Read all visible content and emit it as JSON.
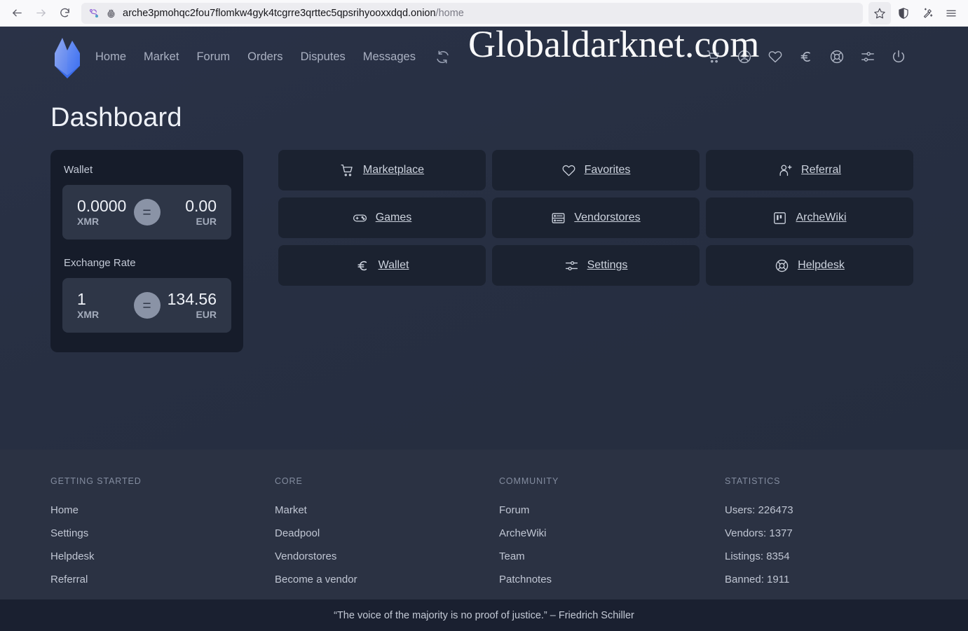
{
  "browser": {
    "back_icon": "back-arrow-icon",
    "forward_icon": "forward-arrow-icon",
    "reload_icon": "reload-icon",
    "tor_circuit_icon": "tor-circuit-icon",
    "onion_icon": "onion-site-icon",
    "url": "arche3pmohqc2fou7flomkw4gyk4tcgrre3qrttec5qpsrihyooxxdqd.onion",
    "url_path": "/home",
    "bookmark_icon": "star-bookmark-icon",
    "shield_icon": "shield-icon",
    "cleanup_icon": "sparkle-cleanup-icon",
    "menu_icon": "hamburger-menu-icon"
  },
  "watermark": "Globaldarknet.com",
  "header": {
    "logo_icon": "arche-crown-logo-icon",
    "nav": [
      {
        "label": "Home"
      },
      {
        "label": "Market"
      },
      {
        "label": "Forum"
      },
      {
        "label": "Orders"
      },
      {
        "label": "Disputes"
      },
      {
        "label": "Messages"
      }
    ],
    "refresh_icon": "refresh-icon",
    "icons": [
      {
        "name": "cart-icon"
      },
      {
        "name": "user-account-icon"
      },
      {
        "name": "heart-favorites-icon"
      },
      {
        "name": "euro-currency-icon"
      },
      {
        "name": "lifebuoy-helpdesk-icon"
      },
      {
        "name": "settings-sliders-icon"
      },
      {
        "name": "power-logout-icon"
      }
    ]
  },
  "page_title": "Dashboard",
  "wallet": {
    "wallet_label": "Wallet",
    "balance": {
      "amount": "0.0000",
      "currency": "XMR",
      "equals": "=",
      "converted": "0.00",
      "converted_currency": "EUR"
    },
    "exchange_label": "Exchange Rate",
    "rate": {
      "amount": "1",
      "currency": "XMR",
      "equals": "=",
      "converted": "134.56",
      "converted_currency": "EUR"
    }
  },
  "tiles": [
    {
      "label": "Marketplace",
      "icon": "cart-icon"
    },
    {
      "label": "Favorites",
      "icon": "heart-icon"
    },
    {
      "label": "Referral",
      "icon": "user-plus-icon"
    },
    {
      "label": "Games",
      "icon": "gamepad-icon"
    },
    {
      "label": "Vendorstores",
      "icon": "store-list-icon"
    },
    {
      "label": "ArcheWiki",
      "icon": "book-wiki-icon"
    },
    {
      "label": "Wallet",
      "icon": "euro-currency-icon"
    },
    {
      "label": "Settings",
      "icon": "settings-sliders-icon"
    },
    {
      "label": "Helpdesk",
      "icon": "lifebuoy-helpdesk-icon"
    }
  ],
  "footer": {
    "columns": [
      {
        "title": "GETTING STARTED",
        "links": [
          "Home",
          "Settings",
          "Helpdesk",
          "Referral"
        ]
      },
      {
        "title": "CORE",
        "links": [
          "Market",
          "Deadpool",
          "Vendorstores",
          "Become a vendor"
        ]
      },
      {
        "title": "COMMUNITY",
        "links": [
          "Forum",
          "ArcheWiki",
          "Team",
          "Patchnotes"
        ]
      },
      {
        "title": "STATISTICS",
        "links": [
          "Users: 226473",
          "Vendors: 1377",
          "Listings: 8354",
          "Banned: 1911"
        ]
      }
    ],
    "quote": "“The voice of the majority is no proof of justice.” – Friedrich Schiller"
  },
  "colors": {
    "page_bg": "#2a3247",
    "card_bg": "#161c2a",
    "tile_bg": "#1b2230",
    "panel_bg": "#2e3647",
    "footer_bg": "#2b3243",
    "quote_bg": "#1a2030",
    "accent_blue": "#4a7cf6",
    "text_primary": "#eef1f7",
    "text_muted": "#a3abbb"
  }
}
